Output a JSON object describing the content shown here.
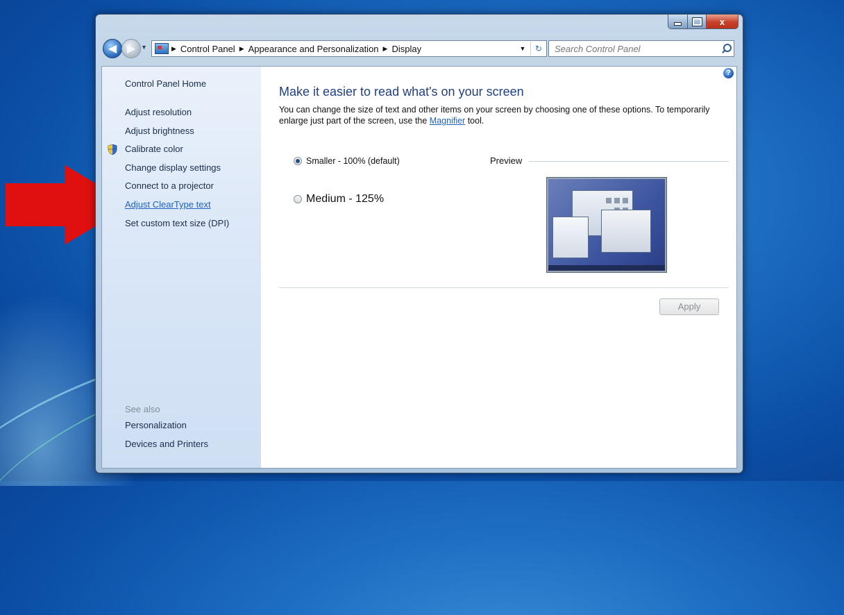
{
  "window": {
    "controls": {
      "minimize": "minimize-icon",
      "maximize": "maximize-icon",
      "close": "close-icon",
      "close_glyph": "x"
    }
  },
  "nav": {
    "back_icon": "back-arrow-icon",
    "forward_icon": "forward-arrow-icon",
    "recent_icon": "dropdown-chevron-icon",
    "breadcrumbs": [
      "Control Panel",
      "Appearance and Personalization",
      "Display"
    ],
    "search_placeholder": "Search Control Panel"
  },
  "sidebar": {
    "home": "Control Panel Home",
    "items": [
      "Adjust resolution",
      "Adjust brightness",
      "Calibrate color",
      "Change display settings",
      "Connect to a projector",
      "Adjust ClearType text",
      "Set custom text size (DPI)"
    ],
    "see_also_label": "See also",
    "see_also": [
      "Personalization",
      "Devices and Printers"
    ]
  },
  "main": {
    "heading": "Make it easier to read what's on your screen",
    "description_pre": "You can change the size of text and other items on your screen by choosing one of these options. To temporarily enlarge just part of the screen, use the ",
    "description_link": "Magnifier",
    "description_post": " tool.",
    "options": [
      {
        "label": "Smaller - 100% (default)",
        "selected": true
      },
      {
        "label": "Medium - 125%",
        "selected": false
      }
    ],
    "preview_label": "Preview",
    "apply_label": "Apply"
  },
  "colors": {
    "heading": "#1f3f82",
    "link": "#1f61c6",
    "arrow": "#e01010",
    "desktop": "#1d6ec3"
  }
}
